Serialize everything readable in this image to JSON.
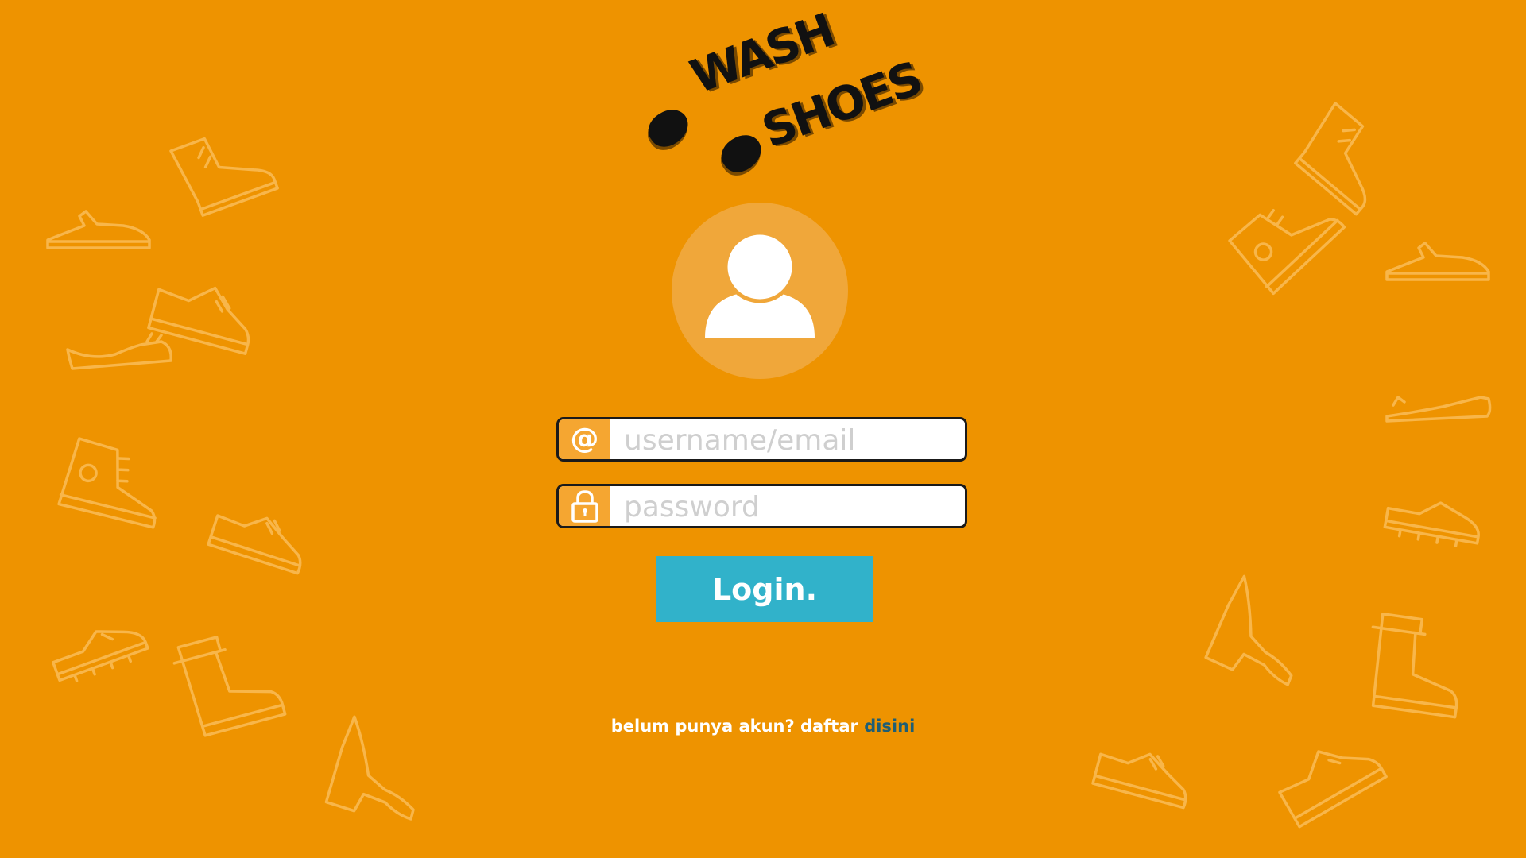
{
  "brand": {
    "line1": "WASH",
    "line2": "SHOES"
  },
  "avatar": {
    "icon": "user-icon"
  },
  "form": {
    "username_placeholder": "username/email",
    "username_icon": "at-icon",
    "username_icon_glyph": "@",
    "password_placeholder": "password",
    "password_icon": "lock-icon",
    "login_label": "Login."
  },
  "register": {
    "prefix": "belum punya akun? daftar",
    "link": "disini"
  },
  "colors": {
    "background": "#EE9300",
    "icon_box": "#F5A631",
    "button": "#31B2CA",
    "link": "#1F5E74",
    "decor": "#F8B64A"
  },
  "decorations": {
    "icon": "shoe-icon"
  }
}
